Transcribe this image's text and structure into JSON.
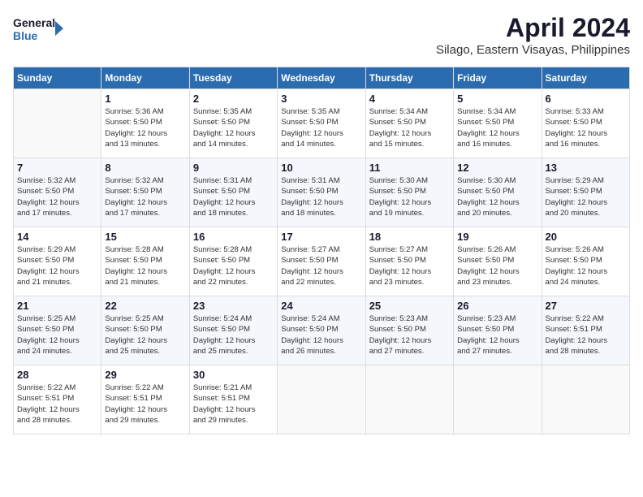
{
  "header": {
    "logo_line1": "General",
    "logo_line2": "Blue",
    "month_title": "April 2024",
    "subtitle": "Silago, Eastern Visayas, Philippines"
  },
  "weekdays": [
    "Sunday",
    "Monday",
    "Tuesday",
    "Wednesday",
    "Thursday",
    "Friday",
    "Saturday"
  ],
  "weeks": [
    [
      {
        "day": "",
        "info": ""
      },
      {
        "day": "1",
        "info": "Sunrise: 5:36 AM\nSunset: 5:50 PM\nDaylight: 12 hours\nand 13 minutes."
      },
      {
        "day": "2",
        "info": "Sunrise: 5:35 AM\nSunset: 5:50 PM\nDaylight: 12 hours\nand 14 minutes."
      },
      {
        "day": "3",
        "info": "Sunrise: 5:35 AM\nSunset: 5:50 PM\nDaylight: 12 hours\nand 14 minutes."
      },
      {
        "day": "4",
        "info": "Sunrise: 5:34 AM\nSunset: 5:50 PM\nDaylight: 12 hours\nand 15 minutes."
      },
      {
        "day": "5",
        "info": "Sunrise: 5:34 AM\nSunset: 5:50 PM\nDaylight: 12 hours\nand 16 minutes."
      },
      {
        "day": "6",
        "info": "Sunrise: 5:33 AM\nSunset: 5:50 PM\nDaylight: 12 hours\nand 16 minutes."
      }
    ],
    [
      {
        "day": "7",
        "info": "Sunrise: 5:32 AM\nSunset: 5:50 PM\nDaylight: 12 hours\nand 17 minutes."
      },
      {
        "day": "8",
        "info": "Sunrise: 5:32 AM\nSunset: 5:50 PM\nDaylight: 12 hours\nand 17 minutes."
      },
      {
        "day": "9",
        "info": "Sunrise: 5:31 AM\nSunset: 5:50 PM\nDaylight: 12 hours\nand 18 minutes."
      },
      {
        "day": "10",
        "info": "Sunrise: 5:31 AM\nSunset: 5:50 PM\nDaylight: 12 hours\nand 18 minutes."
      },
      {
        "day": "11",
        "info": "Sunrise: 5:30 AM\nSunset: 5:50 PM\nDaylight: 12 hours\nand 19 minutes."
      },
      {
        "day": "12",
        "info": "Sunrise: 5:30 AM\nSunset: 5:50 PM\nDaylight: 12 hours\nand 20 minutes."
      },
      {
        "day": "13",
        "info": "Sunrise: 5:29 AM\nSunset: 5:50 PM\nDaylight: 12 hours\nand 20 minutes."
      }
    ],
    [
      {
        "day": "14",
        "info": "Sunrise: 5:29 AM\nSunset: 5:50 PM\nDaylight: 12 hours\nand 21 minutes."
      },
      {
        "day": "15",
        "info": "Sunrise: 5:28 AM\nSunset: 5:50 PM\nDaylight: 12 hours\nand 21 minutes."
      },
      {
        "day": "16",
        "info": "Sunrise: 5:28 AM\nSunset: 5:50 PM\nDaylight: 12 hours\nand 22 minutes."
      },
      {
        "day": "17",
        "info": "Sunrise: 5:27 AM\nSunset: 5:50 PM\nDaylight: 12 hours\nand 22 minutes."
      },
      {
        "day": "18",
        "info": "Sunrise: 5:27 AM\nSunset: 5:50 PM\nDaylight: 12 hours\nand 23 minutes."
      },
      {
        "day": "19",
        "info": "Sunrise: 5:26 AM\nSunset: 5:50 PM\nDaylight: 12 hours\nand 23 minutes."
      },
      {
        "day": "20",
        "info": "Sunrise: 5:26 AM\nSunset: 5:50 PM\nDaylight: 12 hours\nand 24 minutes."
      }
    ],
    [
      {
        "day": "21",
        "info": "Sunrise: 5:25 AM\nSunset: 5:50 PM\nDaylight: 12 hours\nand 24 minutes."
      },
      {
        "day": "22",
        "info": "Sunrise: 5:25 AM\nSunset: 5:50 PM\nDaylight: 12 hours\nand 25 minutes."
      },
      {
        "day": "23",
        "info": "Sunrise: 5:24 AM\nSunset: 5:50 PM\nDaylight: 12 hours\nand 25 minutes."
      },
      {
        "day": "24",
        "info": "Sunrise: 5:24 AM\nSunset: 5:50 PM\nDaylight: 12 hours\nand 26 minutes."
      },
      {
        "day": "25",
        "info": "Sunrise: 5:23 AM\nSunset: 5:50 PM\nDaylight: 12 hours\nand 27 minutes."
      },
      {
        "day": "26",
        "info": "Sunrise: 5:23 AM\nSunset: 5:50 PM\nDaylight: 12 hours\nand 27 minutes."
      },
      {
        "day": "27",
        "info": "Sunrise: 5:22 AM\nSunset: 5:51 PM\nDaylight: 12 hours\nand 28 minutes."
      }
    ],
    [
      {
        "day": "28",
        "info": "Sunrise: 5:22 AM\nSunset: 5:51 PM\nDaylight: 12 hours\nand 28 minutes."
      },
      {
        "day": "29",
        "info": "Sunrise: 5:22 AM\nSunset: 5:51 PM\nDaylight: 12 hours\nand 29 minutes."
      },
      {
        "day": "30",
        "info": "Sunrise: 5:21 AM\nSunset: 5:51 PM\nDaylight: 12 hours\nand 29 minutes."
      },
      {
        "day": "",
        "info": ""
      },
      {
        "day": "",
        "info": ""
      },
      {
        "day": "",
        "info": ""
      },
      {
        "day": "",
        "info": ""
      }
    ]
  ]
}
